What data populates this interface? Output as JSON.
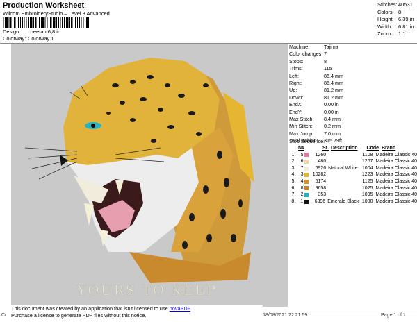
{
  "header": {
    "title": "Production Worksheet",
    "software": "Wilcom EmbroideryStudio – Level 3 Advanced",
    "design_label": "Design:",
    "design_value": "cheetah 6,8 in",
    "colorway_label": "Colorway:",
    "colorway_value": "Colorway 1"
  },
  "summary": {
    "stitches": {
      "label": "Stitches:",
      "value": "40531"
    },
    "colors": {
      "label": "Colors:",
      "value": "8"
    },
    "height": {
      "label": "Height:",
      "value": "6.39 in"
    },
    "width": {
      "label": "Width:",
      "value": "6.81 in"
    },
    "zoom": {
      "label": "Zoom:",
      "value": "1:1"
    }
  },
  "design": {
    "caption": "YOURS TO KEEP"
  },
  "machine_details": [
    {
      "label": "Machine:",
      "value": "Tajima"
    },
    {
      "label": "Color changes:",
      "value": "7"
    },
    {
      "label": "Stops:",
      "value": "8"
    },
    {
      "label": "Trims:",
      "value": "115"
    },
    {
      "label": "Left:",
      "value": "86.4 mm"
    },
    {
      "label": "Right:",
      "value": "86.4 mm"
    },
    {
      "label": "Up:",
      "value": "81.2 mm"
    },
    {
      "label": "Down:",
      "value": "81.2 mm"
    },
    {
      "label": "EndX:",
      "value": "0.00 in"
    },
    {
      "label": "EndY:",
      "value": "0.00 in"
    },
    {
      "label": "Max Stitch:",
      "value": "8.4 mm"
    },
    {
      "label": "Min Stitch:",
      "value": "0.2 mm"
    },
    {
      "label": "Max Jump:",
      "value": "7.0 mm"
    },
    {
      "label": "Total Bobbin:",
      "value": "315.79ft"
    }
  ],
  "stop_sequence": {
    "title": "Stop Sequence:",
    "headers": {
      "n": "N#",
      "st": "St.",
      "description": "Description",
      "code": "Code",
      "brand": "Brand"
    },
    "rows": [
      {
        "stop": "1.",
        "n": "5",
        "color": "#e8789e",
        "st": "1260",
        "description": "",
        "code": "1108",
        "brand": "Madeira Classic 40"
      },
      {
        "stop": "2.",
        "n": "6",
        "color": "#ead9a6",
        "st": "480",
        "description": "",
        "code": "1267",
        "brand": "Madeira Classic 40"
      },
      {
        "stop": "3.",
        "n": "7",
        "color": "#f1ecdc",
        "st": "6926",
        "description": "Natural White",
        "code": "1004",
        "brand": "Madeira Classic 40"
      },
      {
        "stop": "4.",
        "n": "3",
        "color": "#e0b43c",
        "st": "10282",
        "description": "",
        "code": "1223",
        "brand": "Madeira Classic 40"
      },
      {
        "stop": "5.",
        "n": "4",
        "color": "#d3902a",
        "st": "5174",
        "description": "",
        "code": "1125",
        "brand": "Madeira Classic 40"
      },
      {
        "stop": "6.",
        "n": "8",
        "color": "#c2842e",
        "st": "9658",
        "description": "",
        "code": "1025",
        "brand": "Madeira Classic 40"
      },
      {
        "stop": "7.",
        "n": "2",
        "color": "#1fb3c2",
        "st": "353",
        "description": "",
        "code": "1095",
        "brand": "Madeira Classic 40"
      },
      {
        "stop": "8.",
        "n": "1",
        "color": "#111111",
        "st": "6396",
        "description": "Emerald Black",
        "code": "1000",
        "brand": "Madeira Classic 40"
      }
    ]
  },
  "footer": {
    "notice_line1": "This document was created by an application that isn't licensed to use",
    "notice_link": "novaPDF",
    "notice_line2": "Purchase a license to generate PDF files without this notice.",
    "cr": "Cr",
    "printed": "Printed: 18/08/2021 22:21:59",
    "page": "Page 1 of 1"
  }
}
